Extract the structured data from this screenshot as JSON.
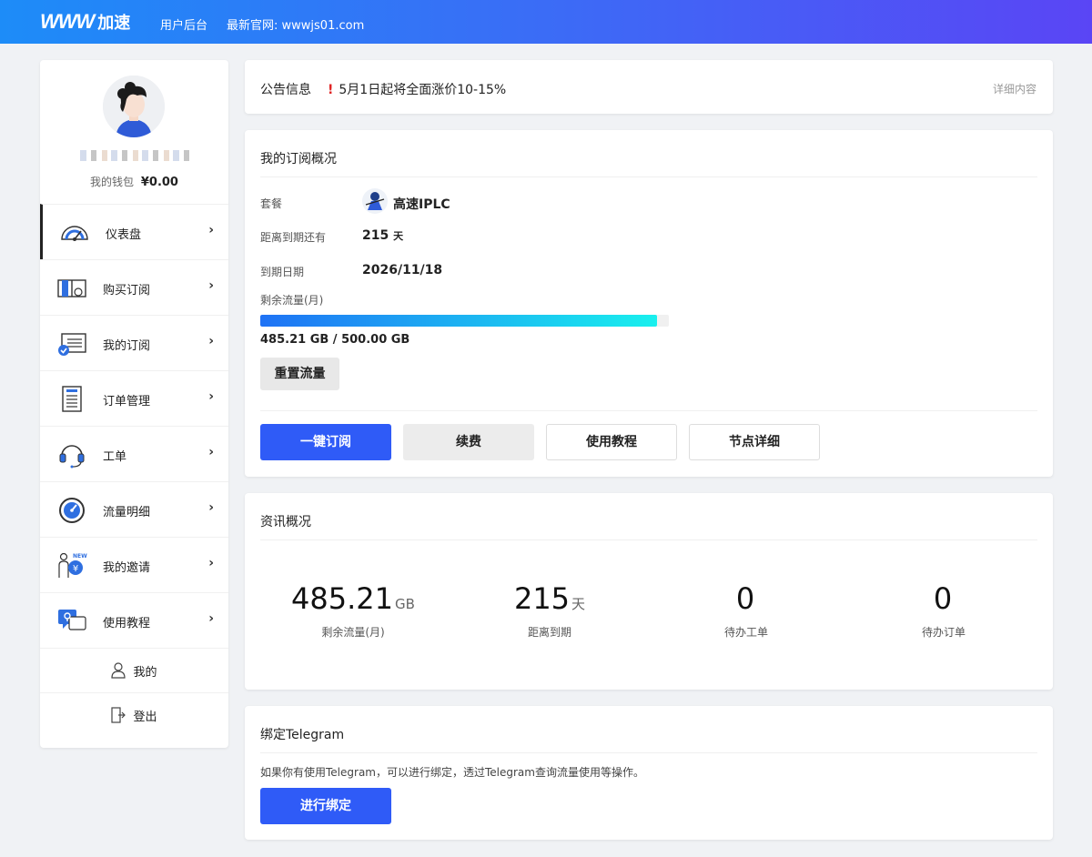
{
  "header": {
    "logo_mark": "WWW",
    "logo_text": "加速",
    "admin_label": "用户后台",
    "site_label": "最新官网: wwwjs01.com"
  },
  "sidebar": {
    "wallet_label": "我的钱包",
    "wallet_value": "¥0.00",
    "items": [
      {
        "label": "仪表盘",
        "icon": "dashboard-gauge-icon"
      },
      {
        "label": "购买订阅",
        "icon": "shopping-book-icon"
      },
      {
        "label": "我的订阅",
        "icon": "subscription-list-icon"
      },
      {
        "label": "订单管理",
        "icon": "order-document-icon"
      },
      {
        "label": "工单",
        "icon": "headset-icon"
      },
      {
        "label": "流量明细",
        "icon": "traffic-meter-icon"
      },
      {
        "label": "我的邀请",
        "icon": "invite-person-icon"
      },
      {
        "label": "使用教程",
        "icon": "tutorial-chat-icon"
      }
    ],
    "profile_label": "我的",
    "logout_label": "登出"
  },
  "announcement": {
    "title": "公告信息",
    "text": "5月1日起将全面涨价10-15%",
    "link": "详细内容"
  },
  "subscription": {
    "title": "我的订阅概况",
    "plan_label": "套餐",
    "plan_value": "高速IPLC",
    "remaining_label": "距离到期还有",
    "remaining_value": "215",
    "remaining_unit": "天",
    "expire_label": "到期日期",
    "expire_value": "2026/11/18",
    "traffic_label": "剩余流量(月)",
    "traffic_value": "485.21 GB / 500.00 GB",
    "traffic_fraction": 0.9704,
    "reset_button": "重置流量",
    "buttons": {
      "subscribe": "一键订阅",
      "renew": "续费",
      "tutorial": "使用教程",
      "nodes": "节点详细"
    }
  },
  "stats": {
    "title": "资讯概况",
    "items": [
      {
        "value": "485.21",
        "unit": "GB",
        "label": "剩余流量(月)"
      },
      {
        "value": "215",
        "unit": "天",
        "label": "距离到期"
      },
      {
        "value": "0",
        "unit": "",
        "label": "待办工单"
      },
      {
        "value": "0",
        "unit": "",
        "label": "待办订单"
      }
    ]
  },
  "telegram": {
    "title": "绑定Telegram",
    "description": "如果你有使用Telegram，可以进行绑定，透过Telegram查询流量使用等操作。",
    "button": "进行绑定"
  },
  "colors": {
    "primary": "#2f5bf7",
    "header_gradient_start": "#1d8cf8",
    "header_gradient_end": "#5a45f5",
    "alert": "#e02424"
  }
}
